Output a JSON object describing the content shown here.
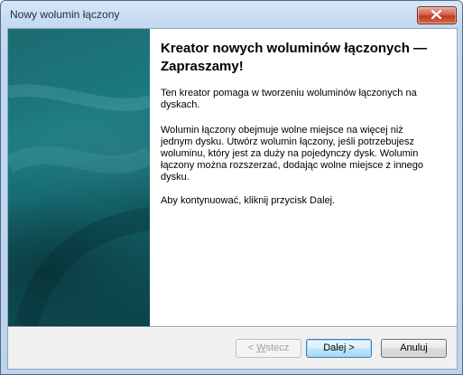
{
  "window": {
    "title": "Nowy wolumin łączony"
  },
  "content": {
    "heading": "Kreator nowych woluminów łączonych — Zapraszamy!",
    "paragraph1": "Ten kreator pomaga w tworzeniu woluminów łączonych na dyskach.",
    "paragraph2": "Wolumin łączony obejmuje wolne miejsce na więcej niż jednym dysku. Utwórz wolumin łączony, jeśli potrzebujesz woluminu, który jest za duży na pojedynczy dysk. Wolumin łączony można rozszerzać, dodając wolne miejsce z innego dysku.",
    "paragraph3": "Aby kontynuować, kliknij przycisk Dalej."
  },
  "buttons": {
    "back_prefix": "< ",
    "back_mnemonic": "W",
    "back_rest": "stecz",
    "next_label": "Dalej >",
    "cancel_label": "Anuluj"
  },
  "icons": {
    "close": "close-icon"
  },
  "colors": {
    "banner_teal": "#1a7b80",
    "close_red": "#c03a22",
    "default_button_border": "#3c7fb1"
  }
}
